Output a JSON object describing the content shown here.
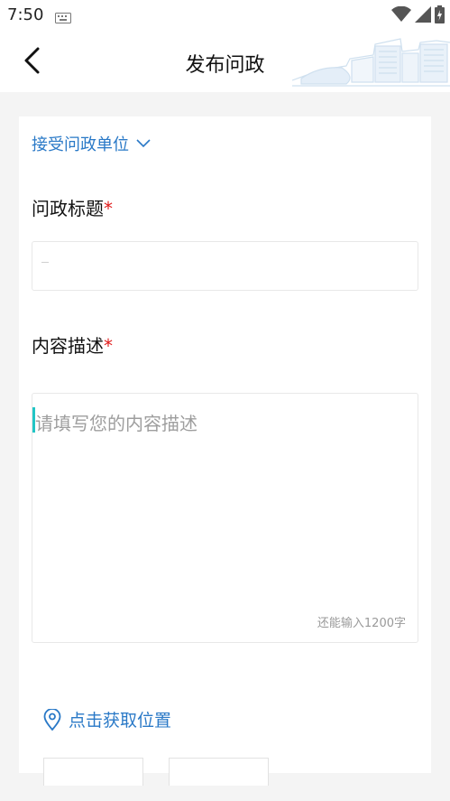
{
  "status_bar": {
    "time": "7:50",
    "icons": [
      "keyboard-icon",
      "wifi-icon",
      "signal-icon",
      "battery-icon"
    ]
  },
  "app_bar": {
    "title": "发布问政",
    "back_icon": "chevron-left-icon"
  },
  "form": {
    "unit_select_label": "接受问政单位",
    "title_label": "问政标题",
    "title_required": "*",
    "title_value": "",
    "content_label": "内容描述",
    "content_required": "*",
    "content_placeholder": "请填写您的内容描述",
    "char_counter": "还能输入1200字",
    "location_label": "点击获取位置"
  },
  "colors": {
    "accent": "#2a79c7",
    "required": "#e01b1b",
    "cursor": "#22c5c5",
    "background": "#f4f4f4"
  }
}
